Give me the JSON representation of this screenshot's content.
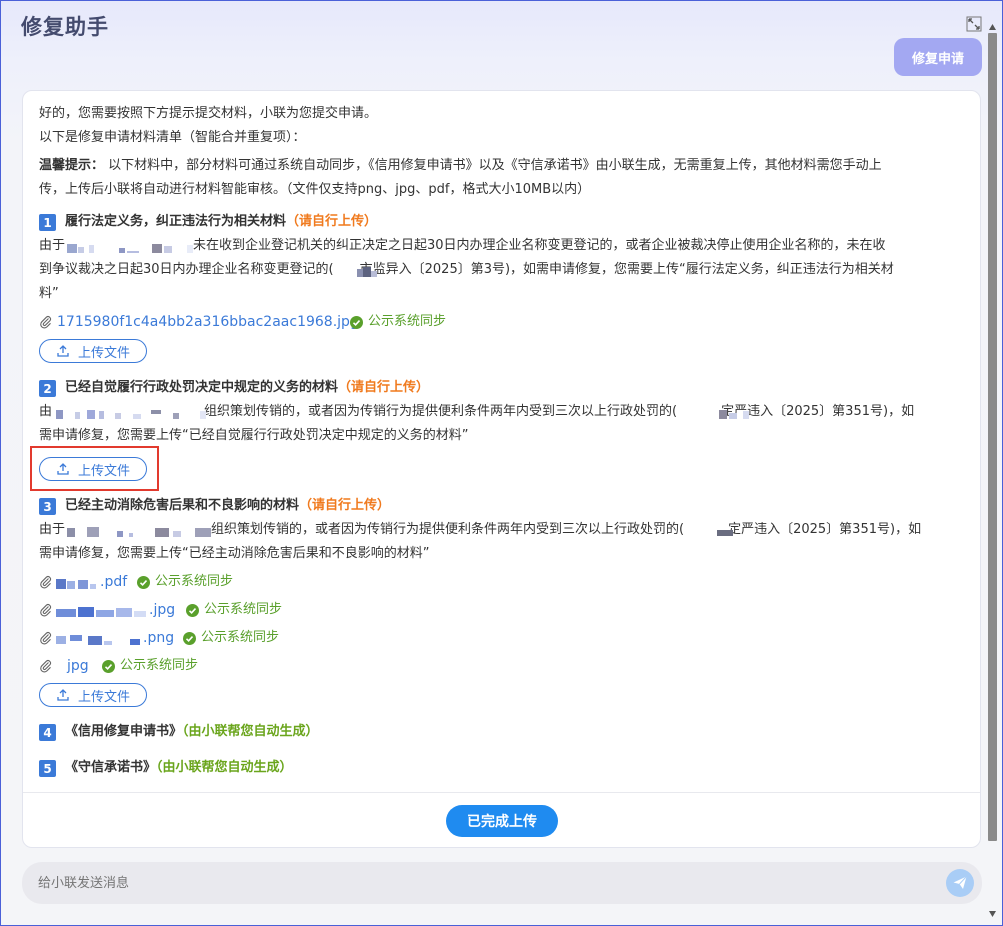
{
  "window": {
    "title": "修复助手"
  },
  "bubble": {
    "label": "修复申请"
  },
  "intro": {
    "line1": "好的，您需要按照下方提示提交材料，小联为您提交申请。",
    "line2": "以下是修复申请材料清单（智能合并重复项）：",
    "tip_label": "温馨提示：",
    "tip_line1": " 以下材料中，部分材料可通过系统自动同步，《信用修复申请书》以及《守信承诺书》由小联生成，无需重复上传，其他材料需您手动上",
    "tip_line2": "传，上传后小联将自动进行材料智能审核。（文件仅支持png、jpg、pdf，格式大小10MB以内）"
  },
  "sections": [
    {
      "num": "1",
      "title": "履行法定义务，纠正违法行为相关材料",
      "tag": "（请自行上传）",
      "desc1a": "由于",
      "desc1b": "未在收到企业登记机关的纠正决定之日起30日内办理企业名称变更登记的，或者企业被裁决停止使用企业名称的，未在收",
      "desc2a": "到争议裁决之日起30日内办理企业名称变更登记的(",
      "desc2b": "市监异入〔2025〕第3号)，如需申请修复，您需要上传“履行法定义务，纠正违法行为相关材",
      "desc3": "料”",
      "files": [
        {
          "name": "1715980f1c4a4bb2a316bbac2aac1968.jpg",
          "sync": "公示系统同步"
        }
      ],
      "upload": "上传文件"
    },
    {
      "num": "2",
      "title": "已经自觉履行行政处罚决定中规定的义务的材料",
      "tag": "（请自行上传）",
      "desc1a": "由",
      "desc1b": "组织策划传销的，或者因为传销行为提供便利条件两年内受到三次以上行政处罚的(",
      "desc1c": "定严违入〔2025〕第351号)，如",
      "desc2": "需申请修复，您需要上传“已经自觉履行行政处罚决定中规定的义务的材料”",
      "upload": "上传文件"
    },
    {
      "num": "3",
      "title": "已经主动消除危害后果和不良影响的材料",
      "tag": "（请自行上传）",
      "desc1a": "由于",
      "desc1b": "组织策划传销的，或者因为传销行为提供便利条件两年内受到三次以上行政处罚的(",
      "desc1c": "定严违入〔2025〕第351号)，如",
      "desc2": "需申请修复，您需要上传“已经主动消除危害后果和不良影响的材料”",
      "files": [
        {
          "name": ".pdf",
          "sync": "公示系统同步"
        },
        {
          "name": ".jpg",
          "sync": "公示系统同步"
        },
        {
          "name": ".png",
          "sync": "公示系统同步"
        },
        {
          "name": "jpg",
          "sync": "公示系统同步"
        }
      ],
      "upload": "上传文件"
    },
    {
      "num": "4",
      "title": "《信用修复申请书》",
      "tag": "（由小联帮您自动生成）"
    },
    {
      "num": "5",
      "title": "《守信承诺书》",
      "tag": "（由小联帮您自动生成）"
    }
  ],
  "done_button": "已完成上传",
  "chat": {
    "placeholder": "给小联发送消息"
  },
  "colors": {
    "accent": "#3b7ad8",
    "orange": "#f07a1e",
    "green": "#6aa51c",
    "highlight": "#e23a2e"
  },
  "icons": {
    "expand": "expand-icon",
    "clip": "paperclip-icon",
    "check": "check-circle-icon",
    "upload": "upload-icon",
    "send": "send-icon"
  }
}
